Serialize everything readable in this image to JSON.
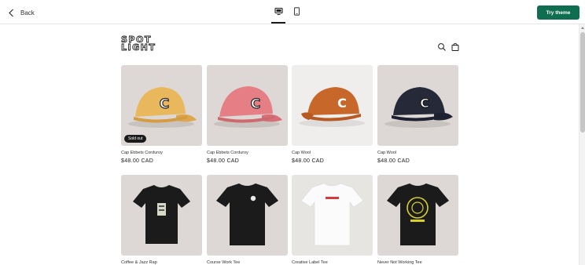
{
  "toolbar": {
    "back_label": "Back",
    "try_theme_label": "Try theme",
    "accent_color": "#0f6e4f"
  },
  "store": {
    "logo_line1": "SPOT",
    "logo_line2": "LIGHT",
    "icons": [
      "search-icon",
      "cart-icon"
    ]
  },
  "products": [
    {
      "name": "Cap Ebbets Corduroy",
      "price": "$48.00 CAD",
      "badge": "Sold out",
      "color": "#e9b85c"
    },
    {
      "name": "Cap Ebbets Corduroy",
      "price": "$48.00 CAD",
      "badge": "",
      "color": "#e57f85"
    },
    {
      "name": "Cap Wool",
      "price": "$48.00 CAD",
      "badge": "",
      "color": "#c8672a"
    },
    {
      "name": "Cap Wool",
      "price": "$48.00 CAD",
      "badge": "",
      "color": "#262a38"
    },
    {
      "name": "Coffee & Jazz Rap",
      "price": "",
      "badge": "",
      "color": "#1b1b1b"
    },
    {
      "name": "Course Work Tee",
      "price": "",
      "badge": "",
      "color": "#1b1b1b"
    },
    {
      "name": "Creative Label Tee",
      "price": "",
      "badge": "",
      "color": "#ffffff"
    },
    {
      "name": "Never Not Working Tee",
      "price": "",
      "badge": "",
      "color": "#1b1b1b"
    }
  ]
}
